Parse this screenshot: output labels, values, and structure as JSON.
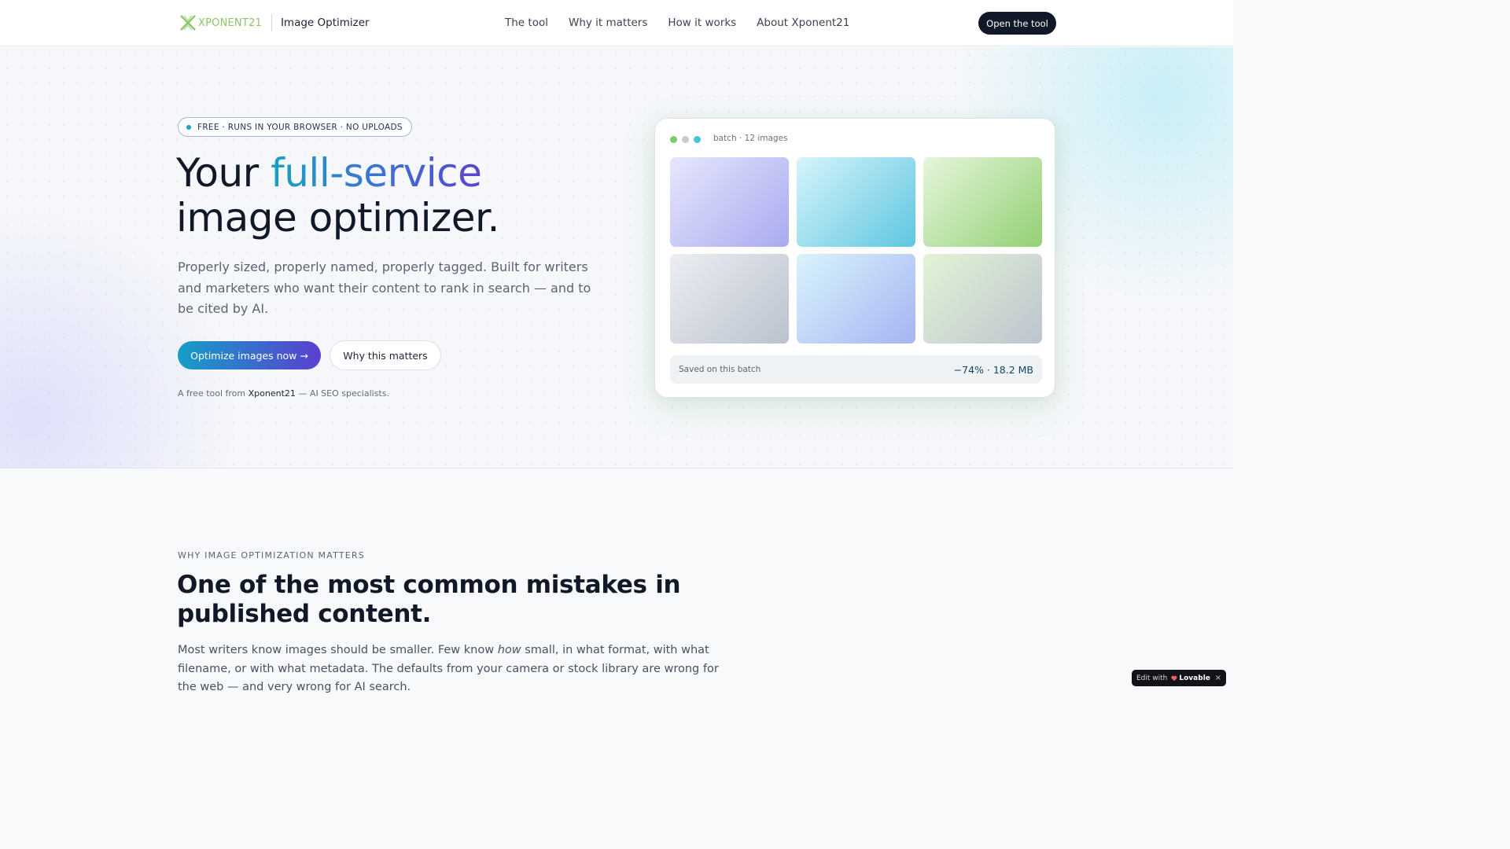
{
  "nav": {
    "logo_text": "XPONENT21",
    "product_name": "Image Optimizer",
    "links": [
      "The tool",
      "Why it matters",
      "How it works",
      "About Xponent21"
    ],
    "cta": "Open the tool"
  },
  "hero": {
    "badge": "FREE · RUNS IN YOUR BROWSER · NO UPLOADS",
    "title_part1": "Your ",
    "title_accent": "full-service",
    "title_part2": "image optimizer.",
    "subtitle": "Properly sized, properly named, properly tagged. Built for writers and marketers who want their content to rank in search — and to be cited by AI.",
    "cta_primary": "Optimize images now →",
    "cta_secondary": "Why this matters",
    "byline_prefix": "A free tool from ",
    "byline_brand": "Xponent21",
    "byline_suffix": " — AI SEO specialists."
  },
  "preview": {
    "label": "batch · 12 images",
    "dot_colors": [
      "#7ccd6a",
      "#c5cad3",
      "#4cc1db"
    ],
    "savings_label": "Saved on this batch",
    "savings_value": "−74% · 18.2 MB"
  },
  "why": {
    "eyebrow": "WHY IMAGE OPTIMIZATION MATTERS",
    "title": "One of the most common mistakes in published content.",
    "body_1": "Most writers know images should be smaller. Few know ",
    "body_em": "how",
    "body_2": " small, in what format, with what filename, or with what metadata. The defaults from your camera or stock library are wrong for the web — and very wrong for AI search."
  },
  "lovable": {
    "prefix": "Edit with",
    "brand": "Lovable",
    "close": "×"
  },
  "colors": {
    "accent_teal": "#1aa1c0",
    "accent_violet": "#5a43cc",
    "dark": "#111827",
    "logo_green": "#8cc56a"
  }
}
